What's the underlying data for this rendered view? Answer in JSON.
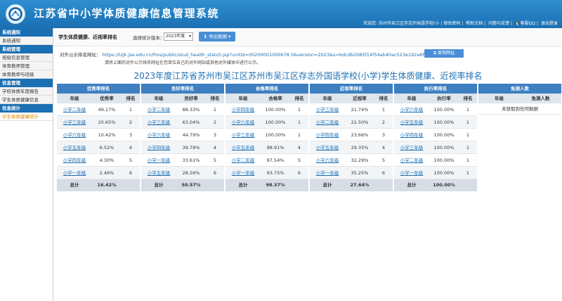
{
  "header": {
    "title": "江苏省中小学体质健康信息管理系统",
    "welcome": "欢迎您: 苏州市吴江区存志外国语学校(小 |",
    "links": [
      "修改密码",
      "帮助文档",
      "问题与反馈",
      "客服QQ",
      "退出登录"
    ]
  },
  "sidebar": {
    "groups": [
      {
        "head": "系统通知",
        "items": [
          "系统通知"
        ]
      },
      {
        "head": "系统管理",
        "items": [
          "班级信息管理",
          "体育教师管理",
          "体育教师与班级"
        ]
      },
      {
        "head": "信息管理",
        "items": [
          "学校体质年度报告",
          "学生体质健康信息"
        ]
      },
      {
        "head": "信息统计",
        "items": [
          "学生体质健康统计"
        ]
      }
    ]
  },
  "toolbar": {
    "title": "学生体质健康、近视率排名",
    "version_label": "选择统计版本：",
    "version_value": "2023年度",
    "export_label": "导出数据"
  },
  "url_row": {
    "label": "对外公示排名网址：",
    "url": "https://tzjk.jse.edu.cn/fms/public/stud_health_stats5.jsp?unitId=00200001000678 0&version=2023&s=bdcdb2085f14f54ab40ac523e192a6f0",
    "copy_label": "复制网址",
    "hint": "请将上面的对外公示排名网址在您单位自己的对外网站或其他对外媒体中进行公示。"
  },
  "page_heading": "2023年度江苏省苏州市吴江区苏州市吴江区存志外国语学校(小学)学生体质健康、近视率排名",
  "tables": [
    {
      "title": "优秀率排名",
      "cols": [
        "年级",
        "优秀率",
        "排名"
      ],
      "rows": [
        [
          "小学二年级",
          "49.17%",
          "1"
        ],
        [
          "小学三年级",
          "20.65%",
          "2"
        ],
        [
          "小学六年级",
          "10.42%",
          "3"
        ],
        [
          "小学五年级",
          "6.52%",
          "4"
        ],
        [
          "小学四年级",
          "4.30%",
          "5"
        ],
        [
          "小学一年级",
          "2.46%",
          "6"
        ]
      ],
      "total": [
        "总计",
        "16.42%",
        ""
      ]
    },
    {
      "title": "良好率排名",
      "cols": [
        "年级",
        "良好率",
        "排名"
      ],
      "rows": [
        [
          "小学二年级",
          "88.33%",
          "1"
        ],
        [
          "小学三年级",
          "63.04%",
          "2"
        ],
        [
          "小学六年级",
          "44.79%",
          "3"
        ],
        [
          "小学四年级",
          "39.78%",
          "4"
        ],
        [
          "小学一年级",
          "33.61%",
          "5"
        ],
        [
          "小学五年级",
          "28.26%",
          "6"
        ]
      ],
      "total": [
        "总计",
        "50.57%",
        ""
      ]
    },
    {
      "title": "合格率排名",
      "cols": [
        "年级",
        "合格率",
        "排名"
      ],
      "rows": [
        [
          "小学四年级",
          "100.00%",
          "1"
        ],
        [
          "小学六年级",
          "100.00%",
          "1"
        ],
        [
          "小学三年级",
          "100.00%",
          "1"
        ],
        [
          "小学五年级",
          "98.91%",
          "4"
        ],
        [
          "小学二年级",
          "97.54%",
          "5"
        ],
        [
          "小学一年级",
          "93.75%",
          "6"
        ]
      ],
      "total": [
        "总计",
        "98.37%",
        ""
      ]
    },
    {
      "title": "近视率排名",
      "cols": [
        "年级",
        "近视率",
        "排名"
      ],
      "rows": [
        [
          "小学三年级",
          "21.74%",
          "1"
        ],
        [
          "小学二年级",
          "22.50%",
          "2"
        ],
        [
          "小学四年级",
          "23.66%",
          "3"
        ],
        [
          "小学五年级",
          "29.35%",
          "4"
        ],
        [
          "小学六年级",
          "32.29%",
          "5"
        ],
        [
          "小学一年级",
          "35.25%",
          "6"
        ]
      ],
      "total": [
        "总计",
        "27.64%",
        ""
      ]
    },
    {
      "title": "执行率排名",
      "cols": [
        "年级",
        "执行率",
        "排名"
      ],
      "rows": [
        [
          "小学六年级",
          "100.00%",
          "1"
        ],
        [
          "小学五年级",
          "100.00%",
          "1"
        ],
        [
          "小学四年级",
          "100.00%",
          "1"
        ],
        [
          "小学三年级",
          "100.00%",
          "1"
        ],
        [
          "小学二年级",
          "100.00%",
          "1"
        ],
        [
          "小学一年级",
          "100.00%",
          "1"
        ]
      ],
      "total": [
        "总计",
        "100.00%",
        ""
      ]
    }
  ],
  "exempt_table": {
    "title": "免测人数",
    "cols": [
      "年级",
      "免测人数"
    ],
    "message": "未获取到任何数据"
  }
}
